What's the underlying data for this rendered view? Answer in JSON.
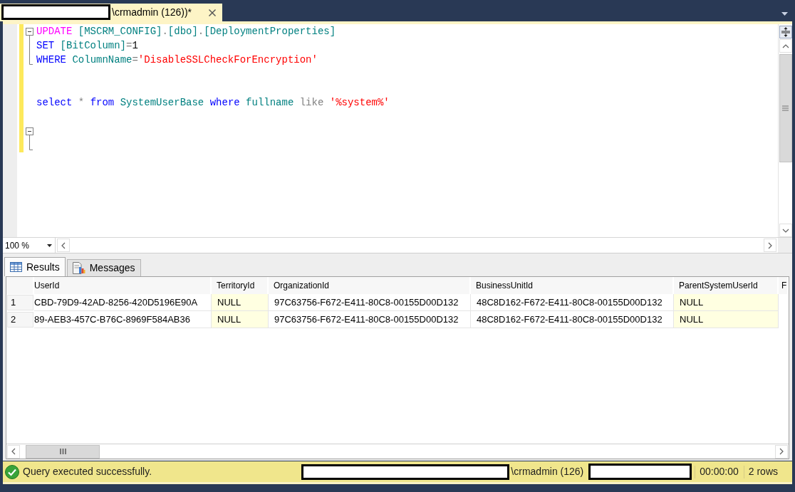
{
  "document_tab": {
    "title": "\\crmadmin (126))*"
  },
  "editor": {
    "lines": [
      {
        "kind": "code",
        "changed": true,
        "fold_start": true,
        "fold_line": false,
        "fold_end": false,
        "tokens": [
          {
            "kind": "system",
            "text": "UPDATE "
          },
          {
            "kind": "identifier",
            "text": "[MSCRM_CONFIG]"
          },
          {
            "kind": "operator",
            "text": "."
          },
          {
            "kind": "identifier",
            "text": "[dbo]"
          },
          {
            "kind": "operator",
            "text": "."
          },
          {
            "kind": "identifier",
            "text": "[DeploymentProperties]"
          }
        ]
      },
      {
        "kind": "code",
        "changed": true,
        "fold_start": false,
        "fold_line": true,
        "fold_end": false,
        "tokens": [
          {
            "kind": "keyword",
            "text": "SET "
          },
          {
            "kind": "identifier",
            "text": "[BitColumn]"
          },
          {
            "kind": "operator",
            "text": "="
          },
          {
            "kind": "number",
            "text": "1"
          }
        ]
      },
      {
        "kind": "code",
        "changed": true,
        "fold_start": false,
        "fold_line": false,
        "fold_end": true,
        "tokens": [
          {
            "kind": "keyword",
            "text": "WHERE "
          },
          {
            "kind": "identifier",
            "text": "ColumnName"
          },
          {
            "kind": "operator",
            "text": "="
          },
          {
            "kind": "string",
            "text": "'DisableSSLCheckForEncryption'"
          }
        ]
      },
      {
        "kind": "blank",
        "changed": true,
        "fold_start": false,
        "fold_line": false,
        "fold_end": false
      },
      {
        "kind": "blank",
        "changed": true,
        "fold_start": false,
        "fold_line": false,
        "fold_end": false
      },
      {
        "kind": "code",
        "changed": true,
        "fold_start": false,
        "fold_line": false,
        "fold_end": false,
        "tokens": [
          {
            "kind": "keyword",
            "text": "select "
          },
          {
            "kind": "operator",
            "text": "* "
          },
          {
            "kind": "keyword",
            "text": "from "
          },
          {
            "kind": "identifier",
            "text": "SystemUserBase "
          },
          {
            "kind": "keyword",
            "text": "where "
          },
          {
            "kind": "identifier",
            "text": "fullname "
          },
          {
            "kind": "operator",
            "text": "like "
          },
          {
            "kind": "string",
            "text": "'%system%'"
          }
        ]
      },
      {
        "kind": "blank",
        "changed": true,
        "fold_start": false,
        "fold_line": false,
        "fold_end": false
      },
      {
        "kind": "blank",
        "changed": true,
        "fold_start": true,
        "fold_line": false,
        "fold_end": false
      },
      {
        "kind": "blank",
        "changed": true,
        "fold_start": false,
        "fold_line": false,
        "fold_end": true
      }
    ],
    "zoom": "100 %"
  },
  "results_tabs": [
    {
      "label": "Results",
      "kind": "grid",
      "selected": true
    },
    {
      "label": "Messages",
      "kind": "messages",
      "selected": false
    }
  ],
  "results_grid": {
    "columns": [
      {
        "label": "UserId"
      },
      {
        "label": "TerritoryId"
      },
      {
        "label": "OrganizationId"
      },
      {
        "label": "BusinessUnitId"
      },
      {
        "label": "ParentSystemUserId"
      },
      {
        "label": "F"
      }
    ],
    "rows": [
      {
        "number": "1",
        "cells": [
          {
            "text": "CBD-79D9-42AD-8256-420D5196E90A",
            "is_null": false
          },
          {
            "text": "NULL",
            "is_null": true
          },
          {
            "text": "97C63756-F672-E411-80C8-00155D00D132",
            "is_null": false
          },
          {
            "text": "48C8D162-F672-E411-80C8-00155D00D132",
            "is_null": false
          },
          {
            "text": "NULL",
            "is_null": true
          }
        ]
      },
      {
        "number": "2",
        "cells": [
          {
            "text": "89-AEB3-457C-B76C-8969F584AB36",
            "is_null": false
          },
          {
            "text": "NULL",
            "is_null": true
          },
          {
            "text": "97C63756-F672-E411-80C8-00155D00D132",
            "is_null": false
          },
          {
            "text": "48C8D162-F672-E411-80C8-00155D00D132",
            "is_null": false
          },
          {
            "text": "NULL",
            "is_null": true
          }
        ]
      }
    ]
  },
  "status_bar": {
    "succeeded": true,
    "message": "Query executed successfully.",
    "connection": "\\crmadmin (126)",
    "elapsed": "00:00:00",
    "rows": "2 rows"
  }
}
